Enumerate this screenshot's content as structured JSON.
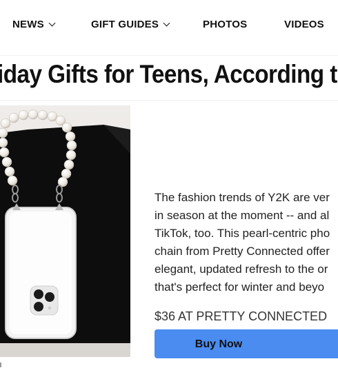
{
  "nav": {
    "items": [
      {
        "label": "NEWS",
        "has_dropdown": true
      },
      {
        "label": "GIFT GUIDES",
        "has_dropdown": true
      },
      {
        "label": "PHOTOS",
        "has_dropdown": false
      },
      {
        "label": "VIDEOS",
        "has_dropdown": false
      }
    ]
  },
  "article": {
    "headline": "iday Gifts for Teens, According to"
  },
  "product": {
    "image_icon": "pearl-phone-chain-product-photo",
    "description": "The fashion trends of Y2K are ver\nin season at the moment -- and al\nTikTok, too. This pearl-centric pho\nchain from Pretty Connected offer\nelegant, updated refresh to the or\nthat's perfect for winter and beyo",
    "price_label": "$36 AT PRETTY CONNECTED",
    "buy_label": "Buy Now"
  },
  "colors": {
    "button_bg": "#4a8cf0",
    "stand": "#0d0d0d",
    "backdrop": "#ece9e6"
  }
}
